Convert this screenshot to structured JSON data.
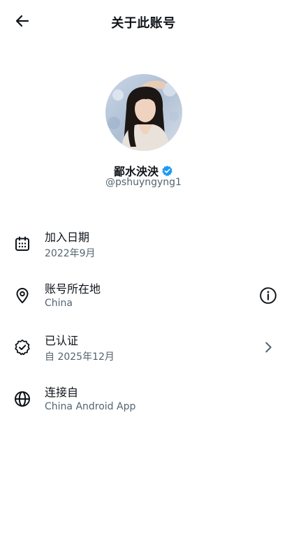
{
  "header": {
    "title": "关于此账号",
    "back_icon": "arrow-left-icon"
  },
  "profile": {
    "name": "鄙水泱泱",
    "handle": "@pshuyngyng1",
    "verified_icon": "verified-badge-icon",
    "verified_color": "#1d9bf0"
  },
  "rows": [
    {
      "icon": "calendar-icon",
      "label": "加入日期",
      "value": "2022年9月"
    },
    {
      "icon": "location-pin-icon",
      "label": "账号所在地",
      "value": "China",
      "action_icon": "info-icon"
    },
    {
      "icon": "verified-check-icon",
      "label": "已认证",
      "value": "自 2025年12月",
      "action_icon": "chevron-right-icon"
    },
    {
      "icon": "globe-icon",
      "label": "连接自",
      "value": "China Android App"
    }
  ]
}
